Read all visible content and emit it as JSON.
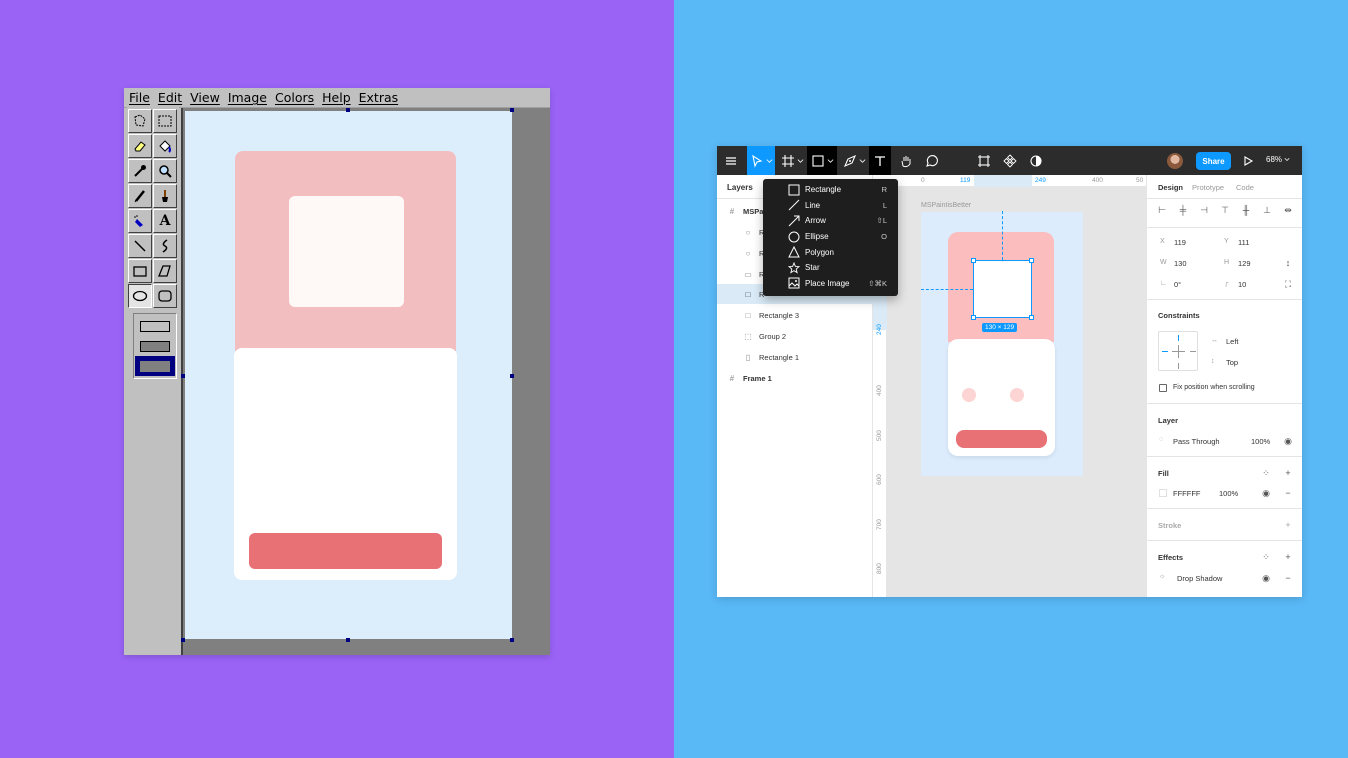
{
  "paint": {
    "menu": [
      "File",
      "Edit",
      "View",
      "Image",
      "Colors",
      "Help",
      "Extras"
    ],
    "tools": [
      "free-select-icon",
      "rect-select-icon",
      "eraser-icon",
      "fill-icon",
      "picker-icon",
      "magnifier-icon",
      "pencil-icon",
      "brush-icon",
      "airbrush-icon",
      "text-icon",
      "line-icon",
      "curve-icon",
      "rectangle-icon",
      "polygon-icon",
      "ellipse-icon",
      "rounded-rect-icon"
    ],
    "text_tool_glyph": "A"
  },
  "figma": {
    "toolbar": {
      "share_label": "Share",
      "zoom_label": "68%"
    },
    "left_panel": {
      "tab_layers": "Layers",
      "frame_name": "MSPa",
      "layers": [
        "R",
        "R",
        "R",
        "R",
        "Rectangle 3",
        "Group 2",
        "Rectangle 1"
      ],
      "frame1": "Frame 1"
    },
    "canvas": {
      "frame_label": "MSPaintisBetter",
      "ruler_top": [
        "0",
        "119",
        "249",
        "400",
        "50"
      ],
      "ruler_left": [
        "240",
        "400",
        "500",
        "600",
        "700",
        "800"
      ],
      "size_label": "130 × 129"
    },
    "dropdown": [
      {
        "label": "Rectangle",
        "shortcut": "R",
        "icon": "rectangle-icon"
      },
      {
        "label": "Line",
        "shortcut": "L",
        "icon": "line-icon"
      },
      {
        "label": "Arrow",
        "shortcut": "⇧L",
        "icon": "arrow-icon"
      },
      {
        "label": "Ellipse",
        "shortcut": "O",
        "icon": "ellipse-icon"
      },
      {
        "label": "Polygon",
        "shortcut": "",
        "icon": "polygon-icon"
      },
      {
        "label": "Star",
        "shortcut": "",
        "icon": "star-icon"
      },
      {
        "label": "Place Image",
        "shortcut": "⇧⌘K",
        "icon": "image-icon"
      }
    ],
    "right_panel": {
      "tabs": [
        "Design",
        "Prototype",
        "Code"
      ],
      "x_label": "X",
      "x": "119",
      "y_label": "Y",
      "y": "111",
      "w_label": "W",
      "w": "130",
      "h_label": "H",
      "h": "129",
      "rotation": "0°",
      "radius": "10",
      "constraints_title": "Constraints",
      "constraint_h": "Left",
      "constraint_v": "Top",
      "fix_position": "Fix position when scrolling",
      "layer_title": "Layer",
      "blend": "Pass Through",
      "layer_opacity": "100%",
      "fill_title": "Fill",
      "fill_hex": "FFFFFF",
      "fill_opacity": "100%",
      "stroke_title": "Stroke",
      "effects_title": "Effects",
      "effect": "Drop Shadow"
    }
  },
  "colors": {
    "left_bg": "#9a63f6",
    "right_bg": "#59b8f6",
    "figma_accent": "#0d99ff",
    "pink": "#f3bec0",
    "button": "#e87175"
  }
}
